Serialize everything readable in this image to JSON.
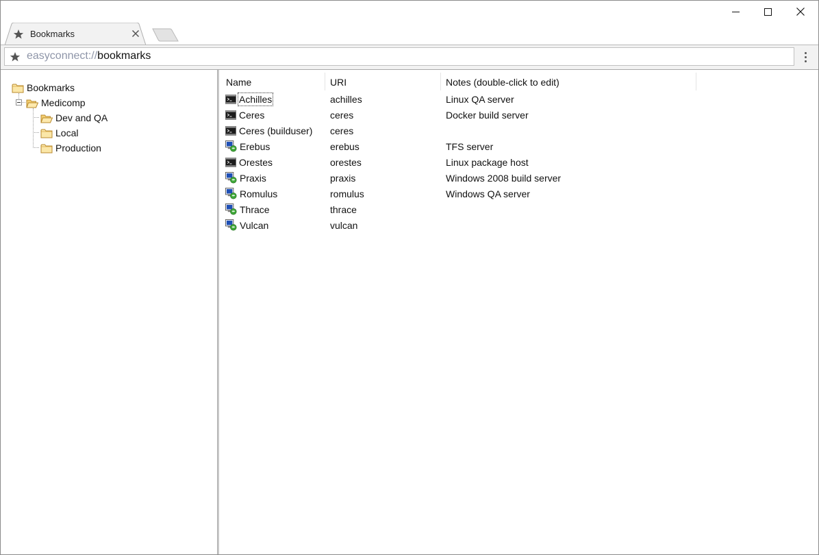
{
  "window": {
    "controls": [
      "minimize-icon",
      "maximize-icon",
      "close-icon"
    ]
  },
  "tab": {
    "title": "Bookmarks",
    "icon": "star-icon"
  },
  "address": {
    "scheme": "easyconnect://",
    "path": "bookmarks"
  },
  "tree": {
    "root": "Bookmarks",
    "child": "Medicomp",
    "grandchildren": [
      "Dev and QA",
      "Local",
      "Production"
    ]
  },
  "list": {
    "columns": [
      "Name",
      "URI",
      "Notes (double-click to edit)"
    ],
    "rows": [
      {
        "name": "Achilles",
        "uri": "achilles",
        "notes": "Linux QA server",
        "icon": "terminal-icon"
      },
      {
        "name": "Ceres",
        "uri": "ceres",
        "notes": "Docker build server",
        "icon": "terminal-icon"
      },
      {
        "name": "Ceres (builduser)",
        "uri": "ceres",
        "notes": "",
        "icon": "terminal-icon"
      },
      {
        "name": "Erebus",
        "uri": "erebus",
        "notes": "TFS server",
        "icon": "remote-desktop-icon"
      },
      {
        "name": "Orestes",
        "uri": "orestes",
        "notes": "Linux package host",
        "icon": "terminal-icon"
      },
      {
        "name": "Praxis",
        "uri": "praxis",
        "notes": "Windows 2008 build server",
        "icon": "remote-desktop-icon"
      },
      {
        "name": "Romulus",
        "uri": "romulus",
        "notes": "Windows QA server",
        "icon": "remote-desktop-icon"
      },
      {
        "name": "Thrace",
        "uri": "thrace",
        "notes": "",
        "icon": "remote-desktop-icon"
      },
      {
        "name": "Vulcan",
        "uri": "vulcan",
        "notes": "",
        "icon": "remote-desktop-icon"
      }
    ]
  }
}
